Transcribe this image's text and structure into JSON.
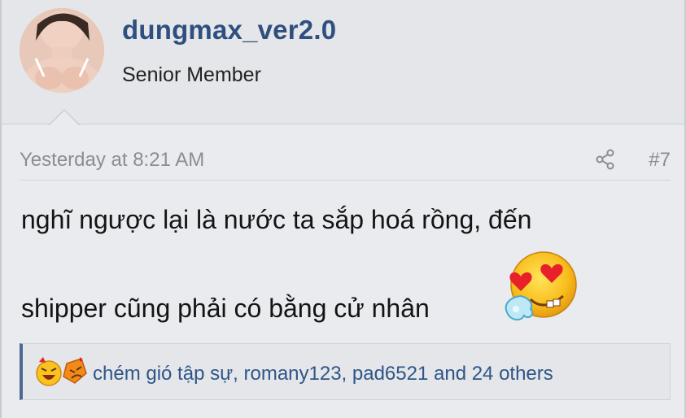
{
  "user": {
    "username": "dungmax_ver2.0",
    "title": "Senior Member",
    "avatar": "user-avatar-photo"
  },
  "post": {
    "timestamp": "Yesterday at 8:21 AM",
    "number": "#7",
    "share_icon": "share-icon",
    "message_line1": "nghĩ ngược lại là nước ta sắp hoá rồng, đến",
    "message_line2": "shipper cũng phải có bằng cử nhân",
    "inline_emoji": "heart-eyes-drooling-emoji"
  },
  "reactions": {
    "icons": [
      "laughing-emoji",
      "angry-emoji"
    ],
    "text": "chém gió tập sự, romany123, pad6521 and 24 others"
  },
  "colors": {
    "username": "#2f4f7f",
    "link": "#2f5687",
    "muted": "#8a8d91",
    "reaction_accent": "#4a6a94"
  }
}
